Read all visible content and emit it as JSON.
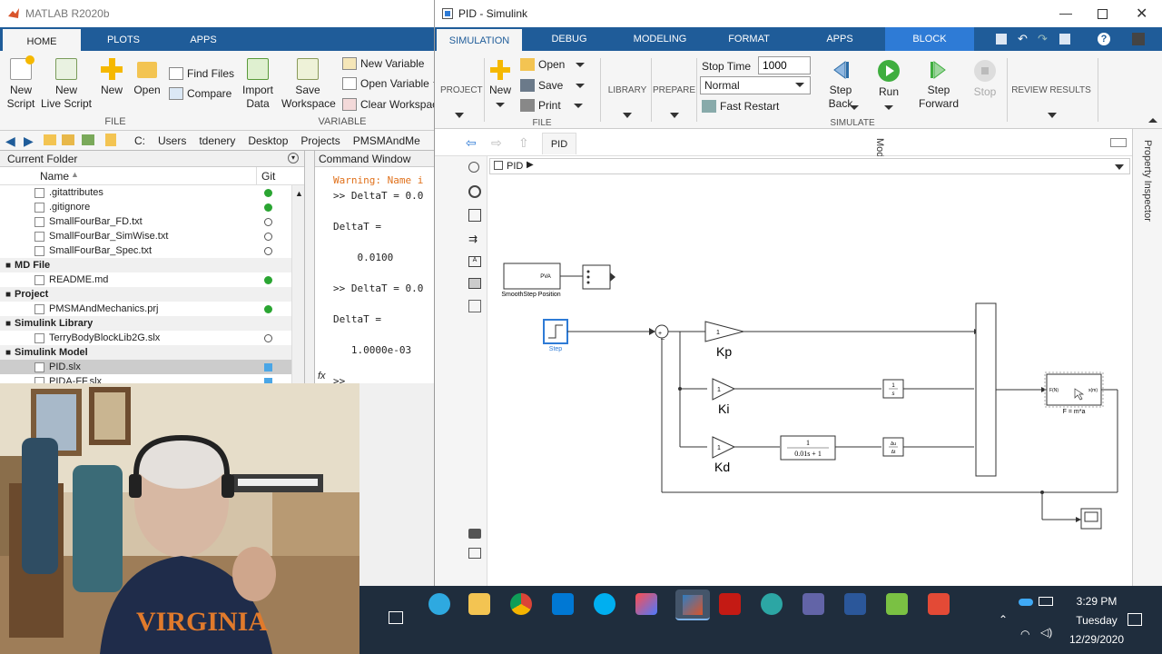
{
  "matlab": {
    "title": "MATLAB R2020b",
    "tabs": [
      "HOME",
      "PLOTS",
      "APPS"
    ],
    "ribbon": {
      "new_script": "New\nScript",
      "new_live_script": "New\nLive Script",
      "new": "New",
      "open": "Open",
      "find_files": "Find Files",
      "compare": "Compare",
      "file_section": "FILE",
      "import_data": "Import\nData",
      "save_workspace": "Save\nWorkspace",
      "new_variable": "New Variable",
      "open_variable": "Open Variable",
      "clear_workspace": "Clear Workspace",
      "variable_section": "VARIABLE"
    },
    "address": [
      "C:",
      "Users",
      "tdenery",
      "Desktop",
      "Projects",
      "PMSMAndMe"
    ],
    "current_folder": {
      "header": "Current Folder",
      "col_name": "Name",
      "col_git": "Git",
      "rows": [
        {
          "type": "file",
          "name": ".gitattributes",
          "git": "green"
        },
        {
          "type": "file",
          "name": ".gitignore",
          "git": "green"
        },
        {
          "type": "file",
          "name": "SmallFourBar_FD.txt",
          "git": "empty"
        },
        {
          "type": "file",
          "name": "SmallFourBar_SimWise.txt",
          "git": "empty"
        },
        {
          "type": "file",
          "name": "SmallFourBar_Spec.txt",
          "git": "empty"
        },
        {
          "type": "group",
          "name": "MD File"
        },
        {
          "type": "file",
          "name": "README.md",
          "git": "green"
        },
        {
          "type": "group",
          "name": "Project"
        },
        {
          "type": "file",
          "name": "PMSMAndMechanics.prj",
          "git": "green"
        },
        {
          "type": "group",
          "name": "Simulink Library"
        },
        {
          "type": "file",
          "name": "TerryBodyBlockLib2G.slx",
          "git": "empty"
        },
        {
          "type": "group",
          "name": "Simulink Model"
        },
        {
          "type": "file",
          "name": "PID.slx",
          "git": "blue",
          "selected": true
        },
        {
          "type": "file",
          "name": "PIDA-FF.slx",
          "git": "blue"
        }
      ]
    },
    "command_window": {
      "header": "Command Window",
      "lines": [
        "Warning: Name i",
        ">> DeltaT = 0.0",
        "",
        "DeltaT =",
        "",
        "    0.0100",
        "",
        ">> DeltaT = 0.0",
        "",
        "DeltaT =",
        "",
        "   1.0000e-03",
        "",
        ">>"
      ]
    }
  },
  "simulink": {
    "title": "PID - Simulink",
    "tabs": [
      "SIMULATION",
      "DEBUG",
      "MODELING",
      "FORMAT",
      "APPS",
      "BLOCK"
    ],
    "ribbon": {
      "project": "PROJECT",
      "new": "New",
      "open": "Open",
      "save": "Save",
      "print": "Print",
      "file_section": "FILE",
      "library": "LIBRARY",
      "prepare": "PREPARE",
      "stop_time_label": "Stop Time",
      "stop_time_value": "1000",
      "sim_mode": "Normal",
      "fast_restart": "Fast Restart",
      "step_back": "Step\nBack",
      "run": "Run",
      "step_forward": "Step\nForward",
      "stop": "Stop",
      "simulate_section": "SIMULATE",
      "review_results": "REVIEW RESULTS"
    },
    "nav_tab": "PID",
    "breadcrumb": "PID",
    "model_browser": "Model Browser",
    "property_inspector": "Property Inspector",
    "diagram": {
      "smoothstep_port": "PVA",
      "smoothstep_label": "SmoothStep Position",
      "step_label": "Step",
      "gain_value": "1",
      "kp": "Kp",
      "ki": "Ki",
      "kd": "Kd",
      "integrator_num": "1",
      "integrator_den": "s",
      "tf_num": "1",
      "tf_den": "0.01s + 1",
      "deriv_num": "Δu",
      "deriv_den": "Δt",
      "plant_in": "F(N)",
      "plant_out": "x(m)",
      "plant_label": "F = m*a"
    }
  },
  "taskbar": {
    "time": "3:29 PM",
    "day": "Tuesday",
    "date": "12/29/2020"
  }
}
